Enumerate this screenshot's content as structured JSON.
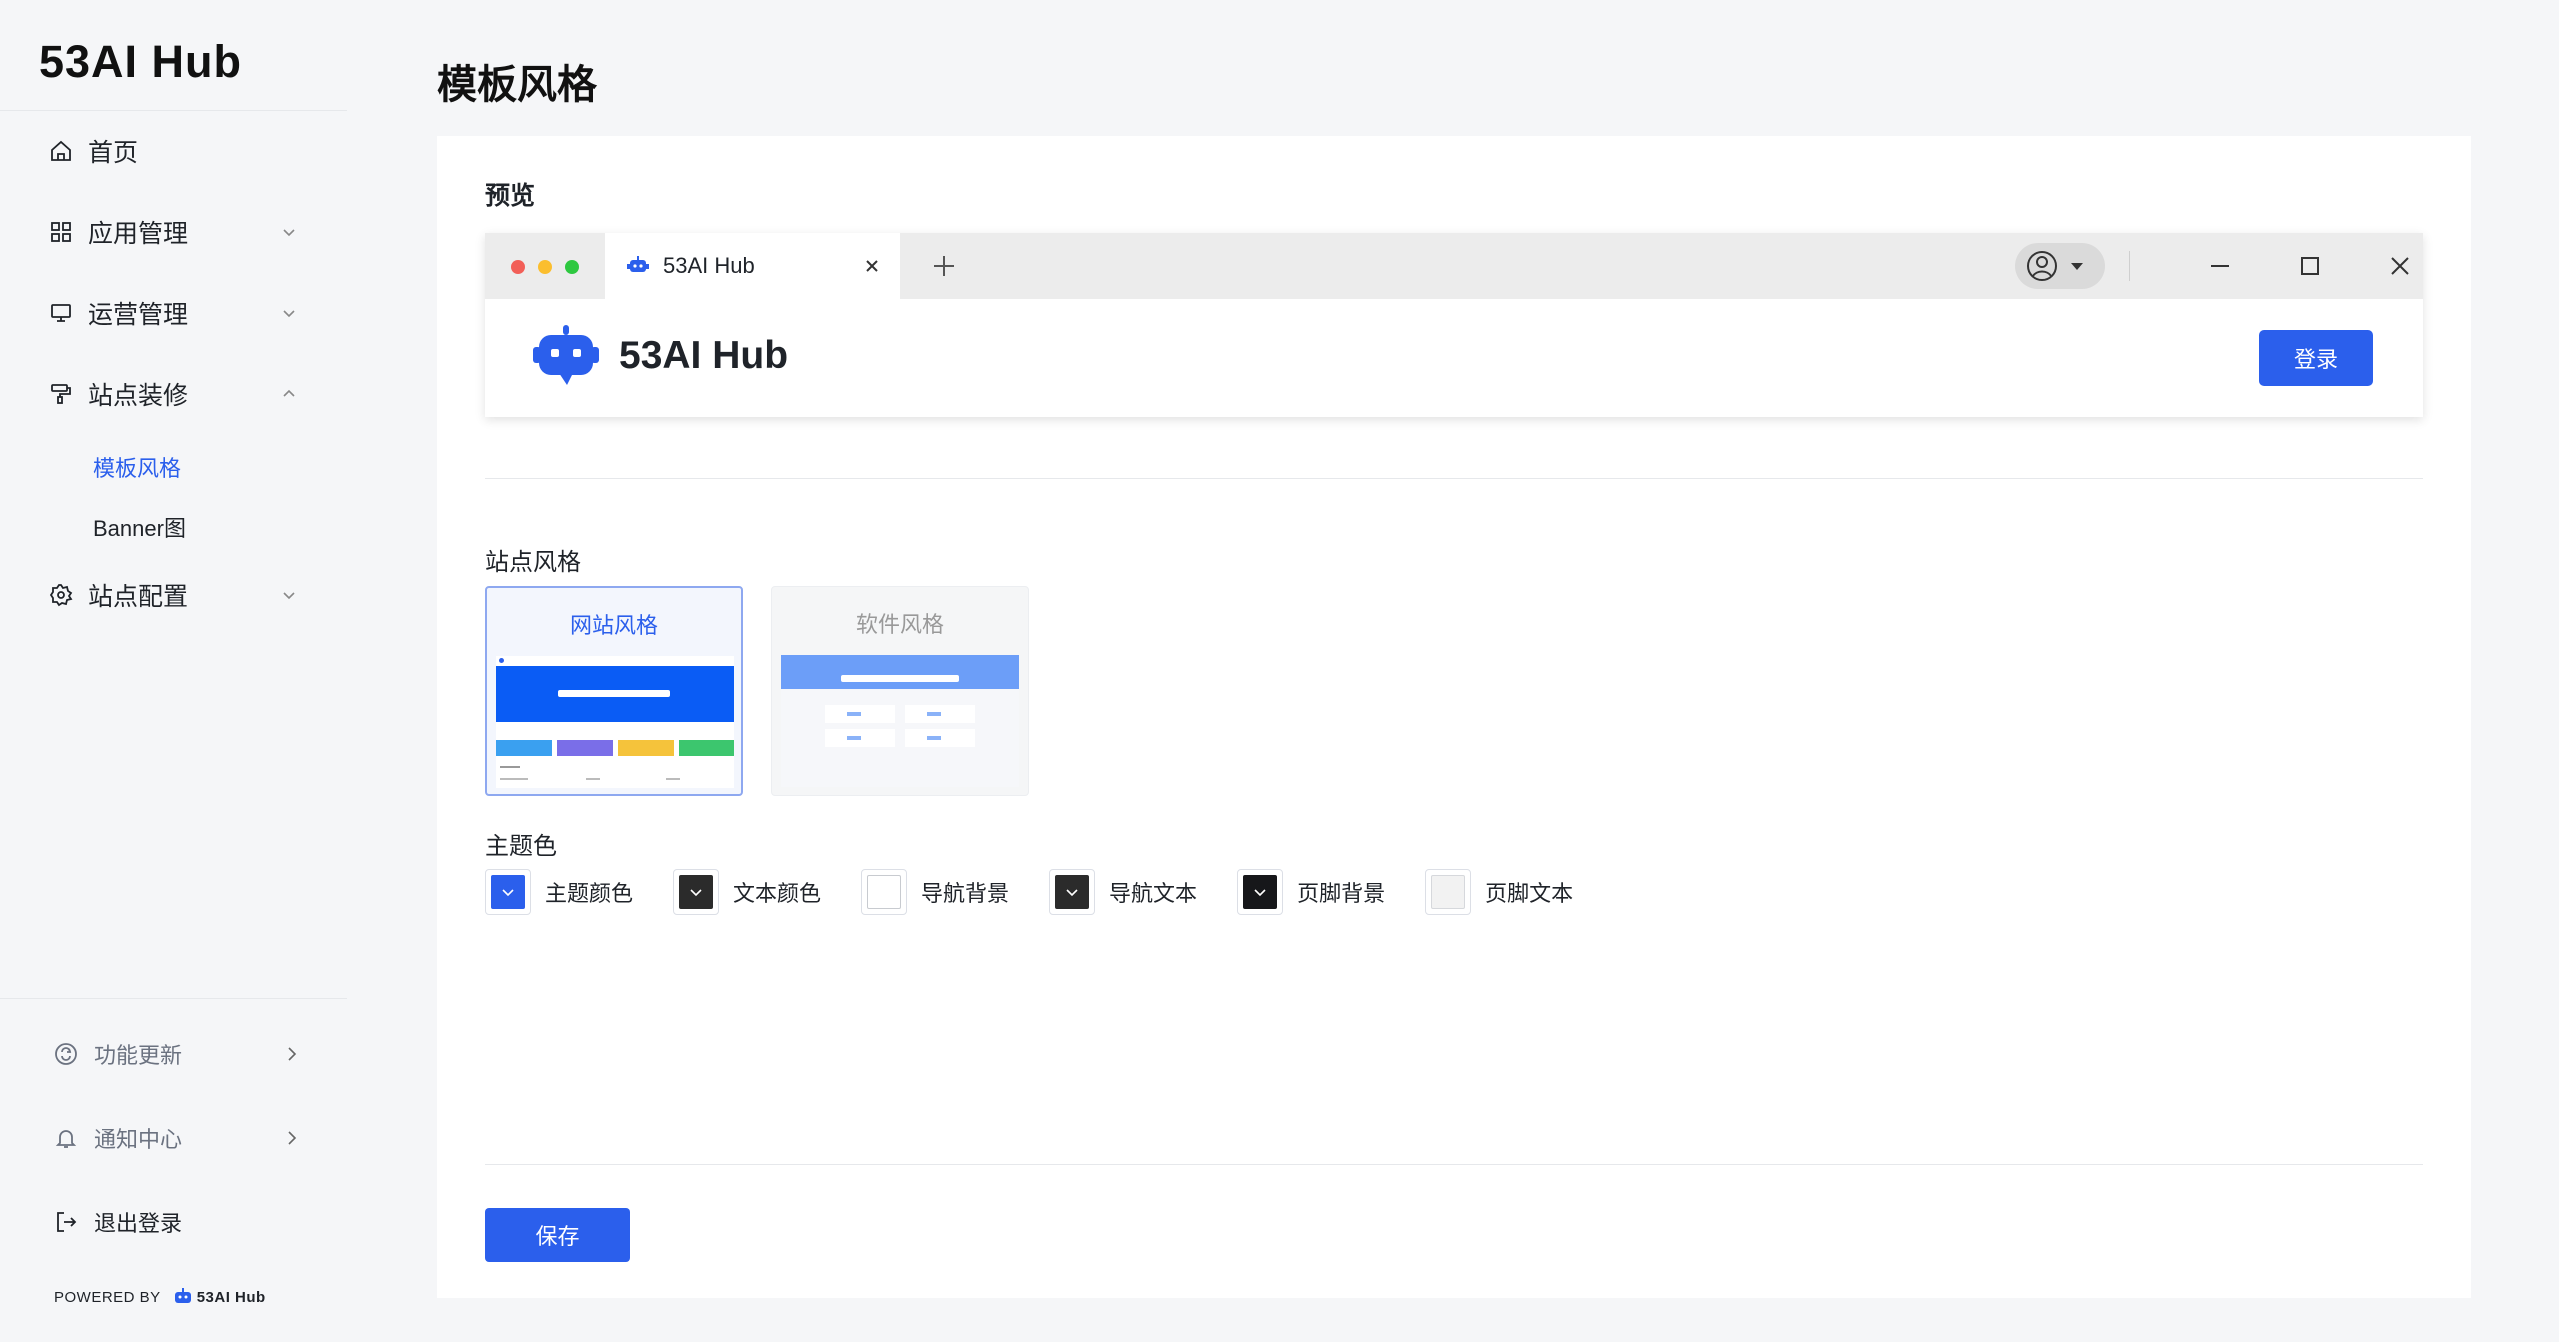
{
  "app": {
    "logo_text": "53AI Hub"
  },
  "sidebar": {
    "items": [
      {
        "label": "首页",
        "icon": "home-icon"
      },
      {
        "label": "应用管理",
        "icon": "grid-icon"
      },
      {
        "label": "运营管理",
        "icon": "monitor-icon"
      },
      {
        "label": "站点装修",
        "icon": "paint-roller-icon"
      },
      {
        "label": "站点配置",
        "icon": "gear-icon"
      }
    ],
    "subitems": [
      {
        "label": "模板风格",
        "active": true
      },
      {
        "label": "Banner图",
        "active": false
      }
    ],
    "bottom": {
      "updates": "功能更新",
      "notifications": "通知中心",
      "logout": "退出登录"
    },
    "powered_by": "POWERED BY",
    "powered_brand": "53AI Hub"
  },
  "main": {
    "title": "模板风格",
    "preview_label": "预览",
    "browser": {
      "tab_title": "53AI Hub",
      "brand_name": "53AI Hub",
      "login_label": "登录"
    },
    "style_section_label": "站点风格",
    "styles": [
      {
        "label": "网站风格",
        "selected": true
      },
      {
        "label": "软件风格",
        "selected": false
      }
    ],
    "theme_section_label": "主题色",
    "swatches": [
      {
        "label": "主题颜色",
        "color": "#2b5fec"
      },
      {
        "label": "文本颜色",
        "color": "#2b2b2b"
      },
      {
        "label": "导航背景",
        "color": "#ffffff"
      },
      {
        "label": "导航文本",
        "color": "#2b2b2b"
      },
      {
        "label": "页脚背景",
        "color": "#16171a"
      },
      {
        "label": "页脚文本",
        "color": "#f2f2f2"
      }
    ],
    "save_label": "保存"
  },
  "colors": {
    "accent": "#2b5fec",
    "page_bg": "#f5f6f8"
  }
}
